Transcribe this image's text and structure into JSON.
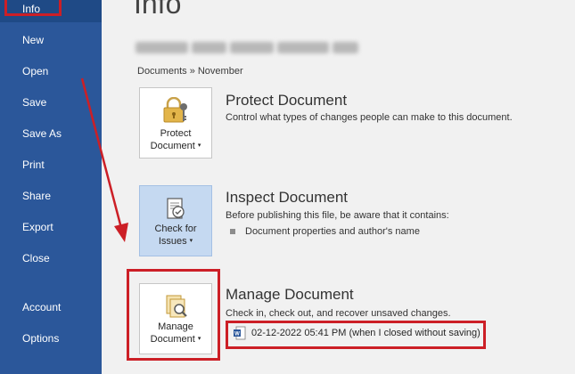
{
  "sidebar": {
    "items": [
      {
        "label": "Info",
        "active": true
      },
      {
        "label": "New"
      },
      {
        "label": "Open"
      },
      {
        "label": "Save"
      },
      {
        "label": "Save As"
      },
      {
        "label": "Print"
      },
      {
        "label": "Share"
      },
      {
        "label": "Export"
      },
      {
        "label": "Close"
      },
      {
        "label": "Account"
      },
      {
        "label": "Options"
      }
    ]
  },
  "main": {
    "title": "Info",
    "path": "Documents » November",
    "protect": {
      "button_line1": "Protect",
      "button_line2": "Document",
      "title": "Protect Document",
      "description": "Control what types of changes people can make to this document."
    },
    "inspect": {
      "button_line1": "Check for",
      "button_line2": "Issues",
      "title": "Inspect Document",
      "description": "Before publishing this file, be aware that it contains:",
      "bullet": "Document properties and author's name"
    },
    "manage": {
      "button_line1": "Manage",
      "button_line2": "Document",
      "title": "Manage Document",
      "description": "Check in, check out, and recover unsaved changes.",
      "version": "02-12-2022 05:41 PM (when I closed without saving)"
    }
  },
  "colors": {
    "sidebar_bg": "#2b579a",
    "annotation_red": "#cc1f26",
    "selected_button_bg": "#c5d9f1"
  }
}
